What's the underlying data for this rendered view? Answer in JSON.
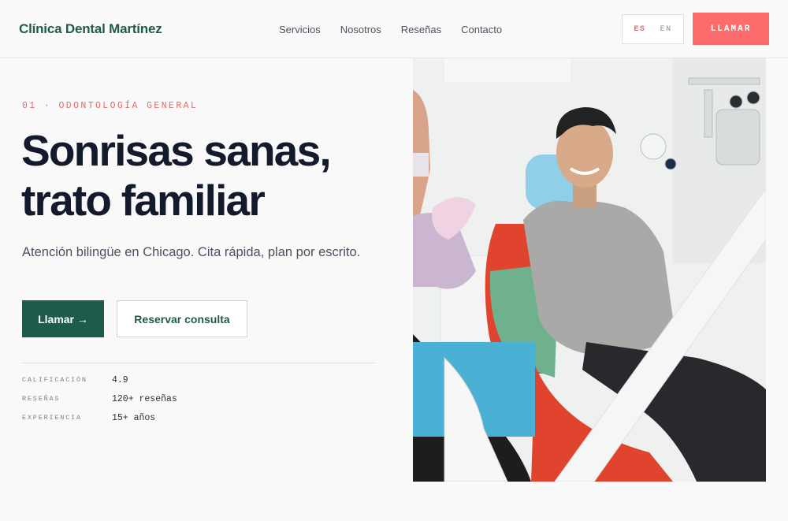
{
  "header": {
    "brand": "Clínica Dental Martínez",
    "nav": [
      "Servicios",
      "Nosotros",
      "Reseñas",
      "Contacto"
    ],
    "lang": {
      "active": "ES",
      "separator": "·",
      "other": "EN"
    },
    "call_label": "LLAMAR"
  },
  "hero": {
    "eyebrow": "01 · ODONTOLOGÍA GENERAL",
    "title_line1": "Sonrisas sanas,",
    "title_line2": "trato familiar",
    "subtitle": "Atención bilingüe en Chicago. Cita rápida, plan por escrito.",
    "primary_cta": "Llamar →",
    "secondary_cta": "Reservar consulta",
    "stats": [
      {
        "label": "CALIFICACIÓN",
        "value": "4.9"
      },
      {
        "label": "RESEÑAS",
        "value": "120+ reseñas"
      },
      {
        "label": "EXPERIENCIA",
        "value": "15+ años"
      }
    ],
    "photo_icon": "dental-patient-photo"
  },
  "colors": {
    "brand_green": "#1f5b4c",
    "accent_coral": "#fb6c6d",
    "eyebrow_coral": "#e46a68",
    "heading": "#131a2c",
    "background": "#f9f9f9"
  }
}
